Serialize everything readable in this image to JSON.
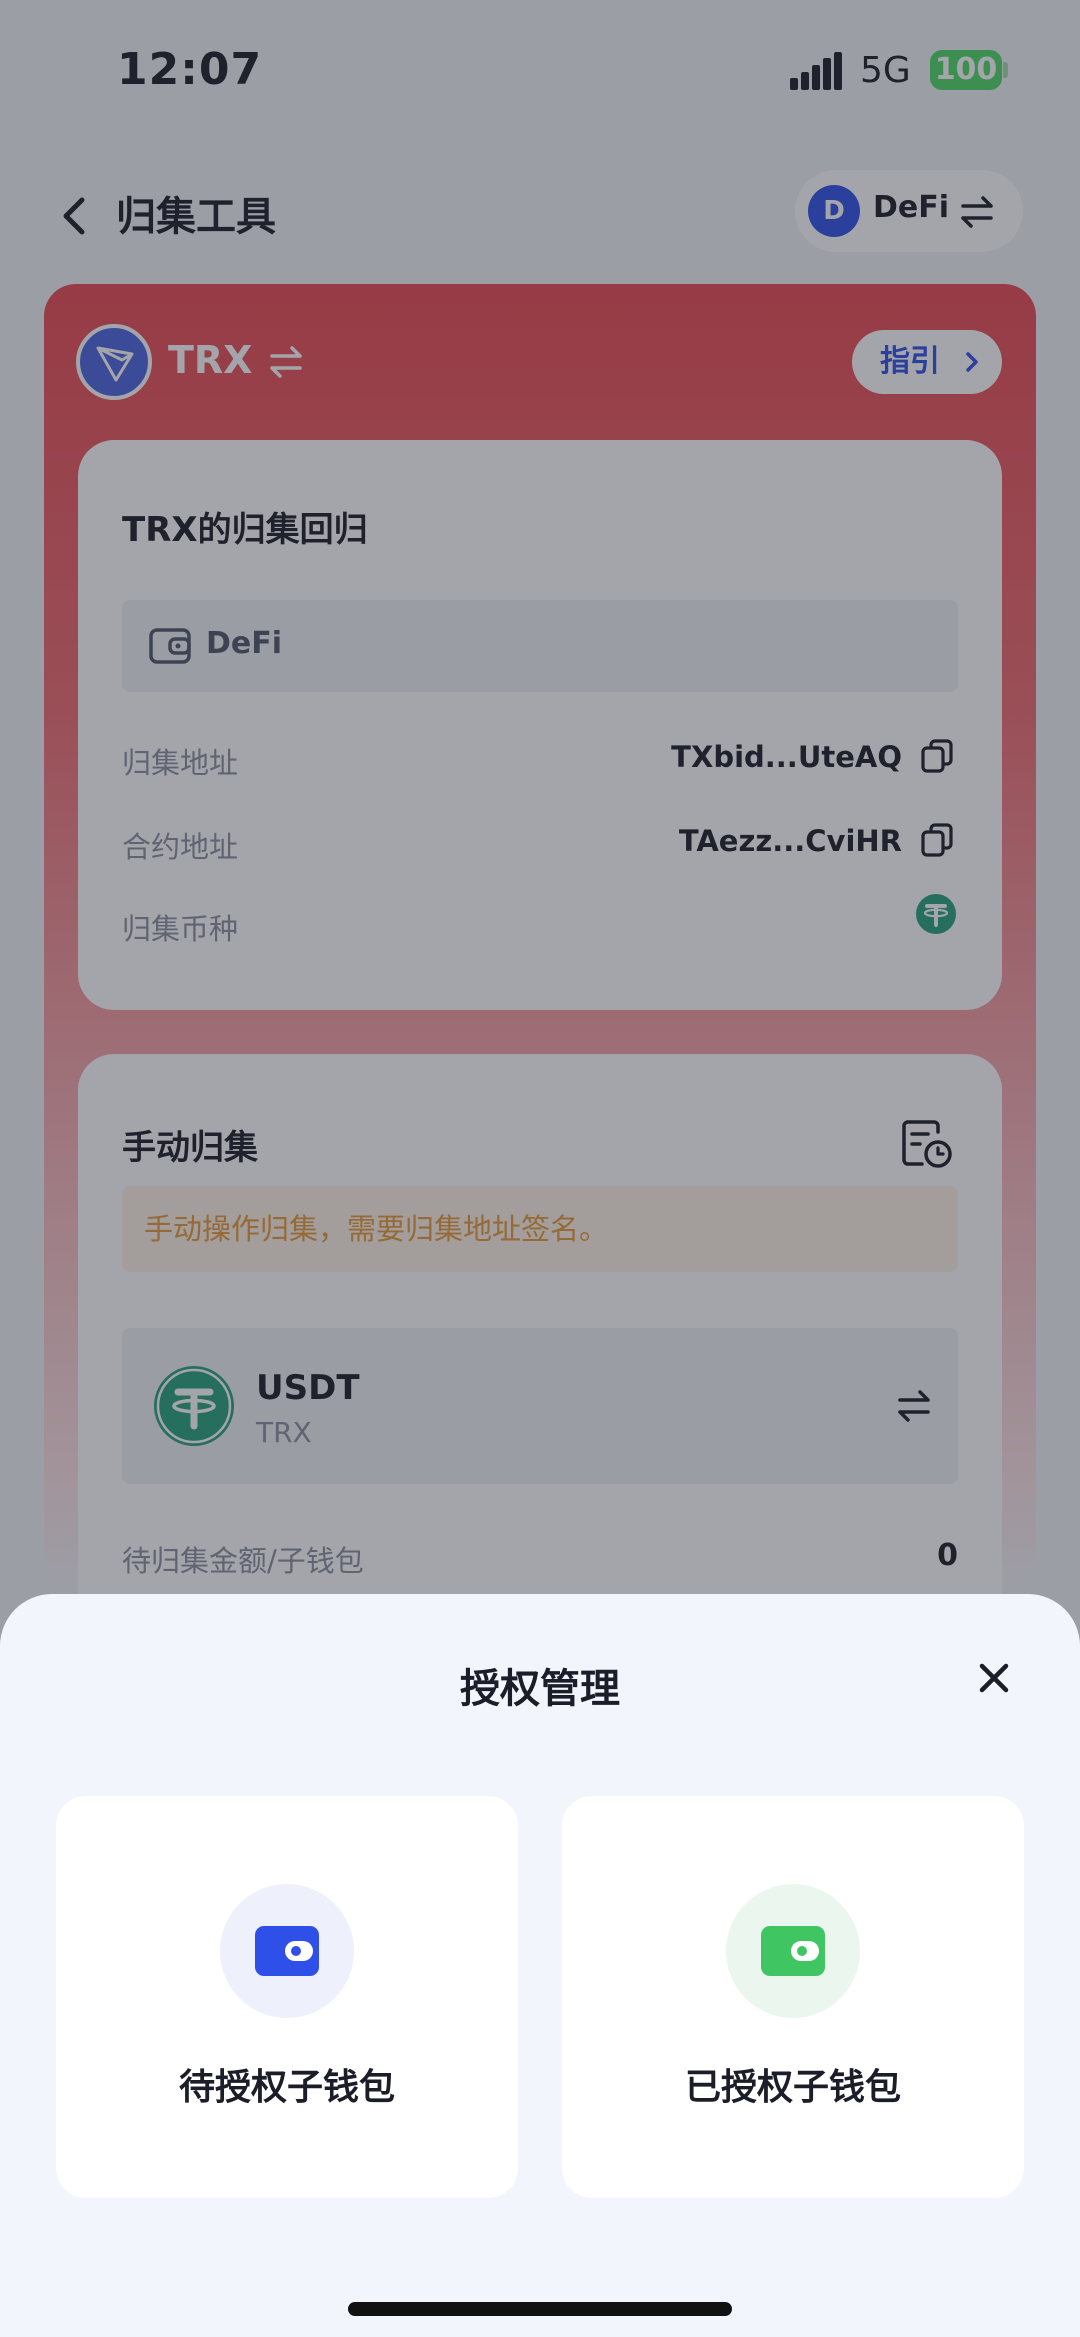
{
  "status_bar": {
    "time": "12:07",
    "network": "5G",
    "battery": "100"
  },
  "navbar": {
    "title": "归集工具",
    "wallet_avatar": "D",
    "wallet_name": "DeFi"
  },
  "hero": {
    "chain": "TRX",
    "guide_label": "指引"
  },
  "collection_card": {
    "title": "TRX的归集回归",
    "wallet_name": "DeFi",
    "rows": [
      {
        "label": "归集地址",
        "value": "TXbid...UteAQ"
      },
      {
        "label": "合约地址",
        "value": "TAezz...CviHR"
      },
      {
        "label": "归集币种"
      }
    ]
  },
  "manual_card": {
    "title": "手动归集",
    "notice": "手动操作归集，需要归集地址签名。",
    "token": {
      "name": "USDT",
      "chain": "TRX"
    },
    "pending_label": "待归集金额/子钱包",
    "pending_value": "0"
  },
  "sheet": {
    "title": "授权管理",
    "options": [
      {
        "label": "待授权子钱包",
        "color": "#2f50e8"
      },
      {
        "label": "已授权子钱包",
        "color": "#3fc663"
      }
    ]
  },
  "colors": {
    "brand_blue": "#2f50e8",
    "trx_red": "#e84a53",
    "tether_green": "#26a17b",
    "warning_orange": "#e69a3a"
  }
}
